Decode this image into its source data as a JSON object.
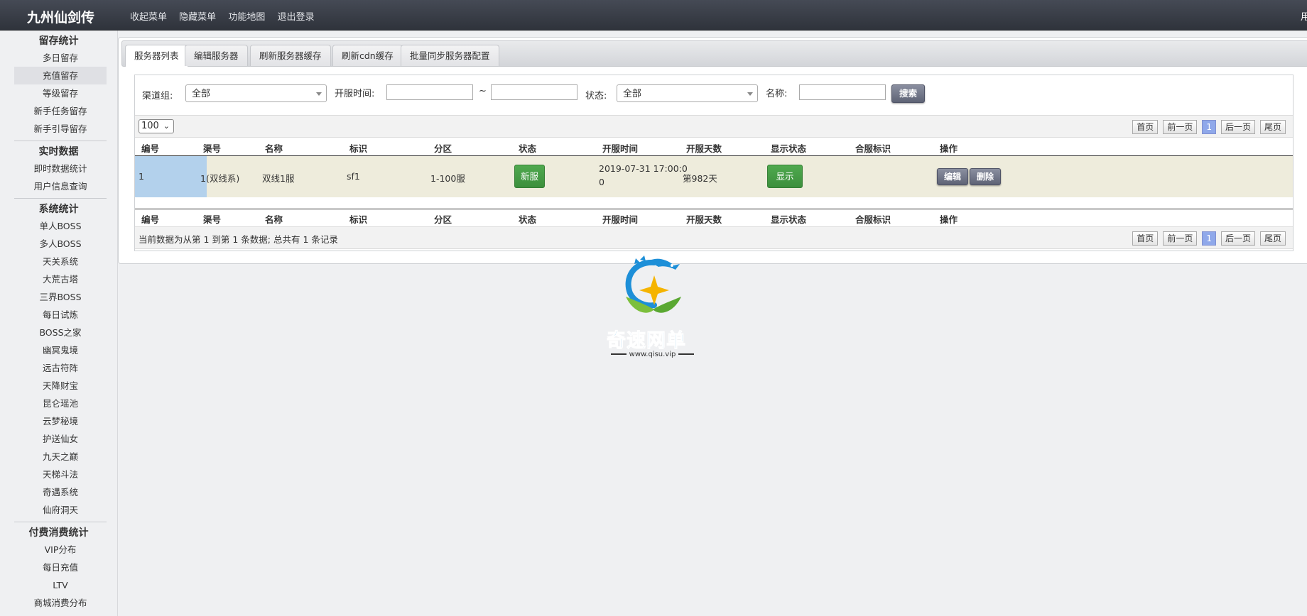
{
  "topbar": {
    "brand": "九州仙剑传",
    "nav": [
      "收起菜单",
      "隐藏菜单",
      "功能地图",
      "退出登录"
    ],
    "right_text": "用"
  },
  "sidebar": {
    "groups": [
      {
        "title": "留存统计",
        "items": [
          "多日留存",
          "充值留存",
          "等级留存",
          "新手任务留存",
          "新手引导留存"
        ],
        "active": "充值留存"
      },
      {
        "title": "实时数据",
        "items": [
          "即时数据统计",
          "用户信息查询"
        ]
      },
      {
        "title": "系统统计",
        "items": [
          "单人BOSS",
          "多人BOSS",
          "天关系统",
          "大荒古塔",
          "三界BOSS",
          "每日试炼",
          "BOSS之家",
          "幽冥鬼境",
          "远古符阵",
          "天降财宝",
          "昆仑瑶池",
          "云梦秘境",
          "护送仙女",
          "九天之巅",
          "天梯斗法",
          "奇遇系统",
          "仙府洞天"
        ]
      },
      {
        "title": "付费消费统计",
        "items": [
          "VIP分布",
          "每日充值",
          "LTV",
          "商城消费分布"
        ]
      }
    ]
  },
  "tabs": [
    "服务器列表",
    "编辑服务器",
    "刷新服务器缓存",
    "刷新cdn缓存",
    "批量同步服务器配置"
  ],
  "filters": {
    "channel_label": "渠道组:",
    "channel_value": "全部",
    "open_time_label": "开服时间:",
    "range_sep": "~",
    "status_label": "状态:",
    "status_value": "全部",
    "name_label": "名称:",
    "search_button": "搜索"
  },
  "table": {
    "page_size": "100",
    "pager": [
      "首页",
      "前一页",
      "1",
      "后一页",
      "尾页"
    ],
    "columns": [
      "编号",
      "渠号",
      "名称",
      "标识",
      "分区",
      "状态",
      "开服时间",
      "开服天数",
      "显示状态",
      "合服标识",
      "操作"
    ],
    "rows": [
      {
        "id": "1",
        "channel": "1(双线系)",
        "name": "双线1服",
        "tag": "sf1",
        "zone": "1-100服",
        "status": "新服",
        "open_time_line1": "2019-07-31 17:00:0",
        "open_time_line2": "0",
        "days": "第982天",
        "display_status": "显示",
        "merge_tag": "",
        "edit": "编辑",
        "delete": "删除"
      }
    ],
    "summary": "当前数据为从第 1 到第 1 条数据; 总共有 1 条记录"
  },
  "watermark": {
    "text": "奇速网单",
    "url": "www.qisu.vip"
  },
  "colors": {
    "topbar": "#3a3e47",
    "row_bg": "#eeecdc",
    "selected_cell": "#b3d1ec",
    "green_button": "#449d44",
    "current_page": "#8fa8ea"
  }
}
